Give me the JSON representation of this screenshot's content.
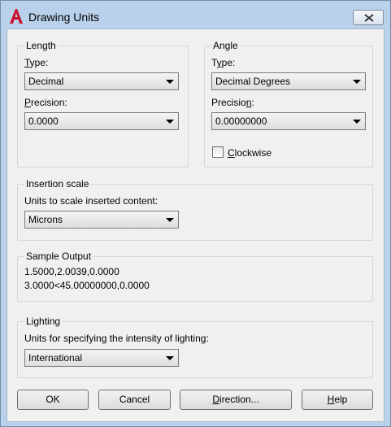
{
  "window": {
    "title": "Drawing Units",
    "close_glyph": "✕"
  },
  "length": {
    "group_title": "Length",
    "type_label_u": "T",
    "type_label_rest": "ype:",
    "type_value": "Decimal",
    "precision_label_u": "P",
    "precision_label_rest": "recision:",
    "precision_value": "0.0000"
  },
  "angle": {
    "group_title": "Angle",
    "type_label_pre": "T",
    "type_label_u": "y",
    "type_label_rest": "pe:",
    "type_value": "Decimal Degrees",
    "precision_label_pre": "Precisio",
    "precision_label_u": "n",
    "precision_label_rest": ":",
    "precision_value": "0.00000000",
    "clockwise_label_u": "C",
    "clockwise_label_rest": "lockwise",
    "clockwise_checked": false
  },
  "insertion": {
    "group_title": "Insertion scale",
    "units_label": "Units to scale inserted content:",
    "units_value": "Microns"
  },
  "sample": {
    "group_title": "Sample Output",
    "line1": "1.5000,2.0039,0.0000",
    "line2": "3.0000<45.00000000,0.0000"
  },
  "lighting": {
    "group_title": "Lighting",
    "units_label": "Units for specifying the intensity of lighting:",
    "units_value": "International"
  },
  "buttons": {
    "ok": "OK",
    "cancel": "Cancel",
    "direction_u": "D",
    "direction_rest": "irection...",
    "help_u": "H",
    "help_rest": "elp"
  },
  "colors": {
    "title_bar": "#b9d1ea",
    "dialog_bg": "#f0f0f0",
    "app_icon_red": "#c8102e"
  }
}
